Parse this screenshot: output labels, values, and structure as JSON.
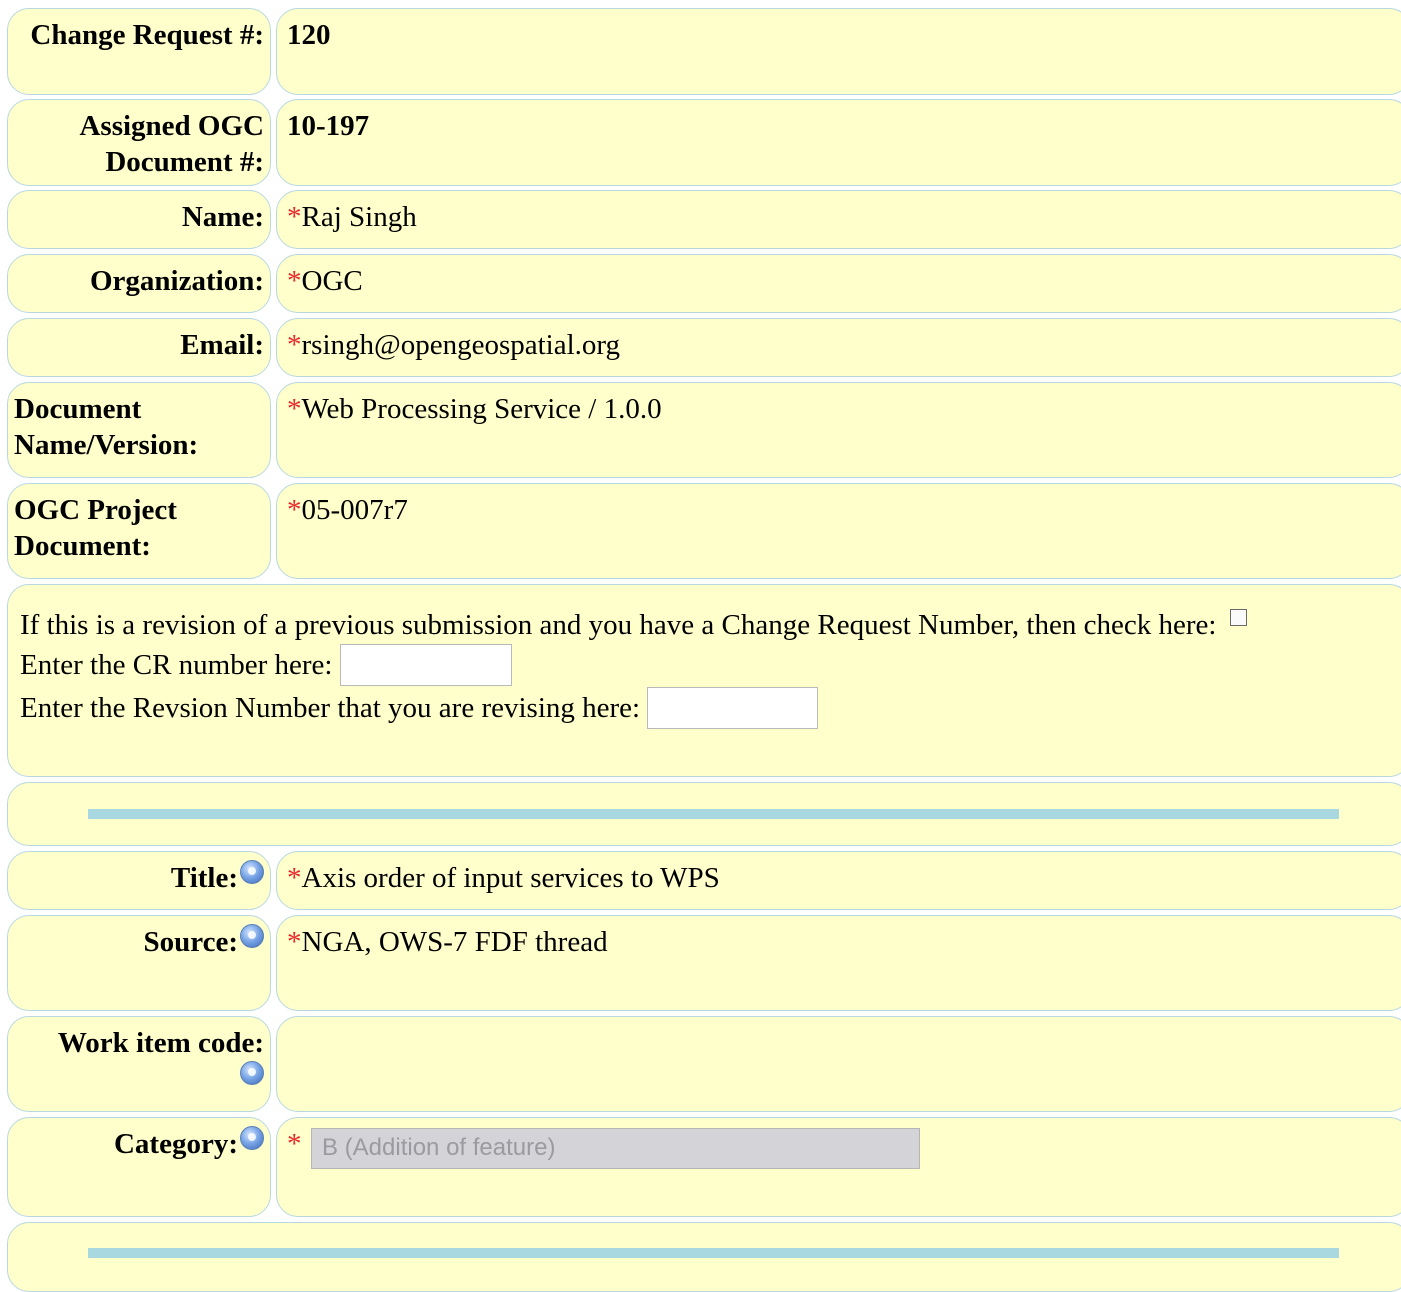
{
  "required_marker": "*",
  "rows": {
    "change_request": {
      "label": "Change Request #:",
      "value": "120"
    },
    "assigned_doc": {
      "label": "Assigned OGC Document #:",
      "value": "10-197"
    },
    "name": {
      "label": "Name:",
      "value": "Raj Singh"
    },
    "organization": {
      "label": "Organization:",
      "value": "OGC"
    },
    "email": {
      "label": "Email:",
      "value": "rsingh@opengeospatial.org"
    },
    "doc_name_version": {
      "label": "Document Name/Version:",
      "value": "Web Processing Service / 1.0.0"
    },
    "ogc_project_doc": {
      "label": "OGC Project Document:",
      "value": "05-007r7"
    },
    "title": {
      "label": "Title:",
      "value": "Axis order of input services to WPS"
    },
    "source": {
      "label": "Source:",
      "value": "NGA, OWS-7 FDF thread"
    },
    "work_item_code": {
      "label": "Work item code:",
      "value": ""
    },
    "category": {
      "label": "Category:",
      "selected": "B (Addition of feature)"
    }
  },
  "revision": {
    "check_text": "If this is a revision of a previous submission and you have a Change Request Number, then check here:",
    "cr_number_label": "Enter the CR number here:",
    "revision_number_label": "Enter the Revsion Number that you are revising here:",
    "cr_number_value": "",
    "revision_number_value": ""
  },
  "colors": {
    "cell_background": "#ffffcc",
    "cell_border": "#b8d8e0",
    "divider": "#a9d8e0",
    "required": "#e8282a"
  },
  "icons": {
    "help": "help-icon"
  }
}
